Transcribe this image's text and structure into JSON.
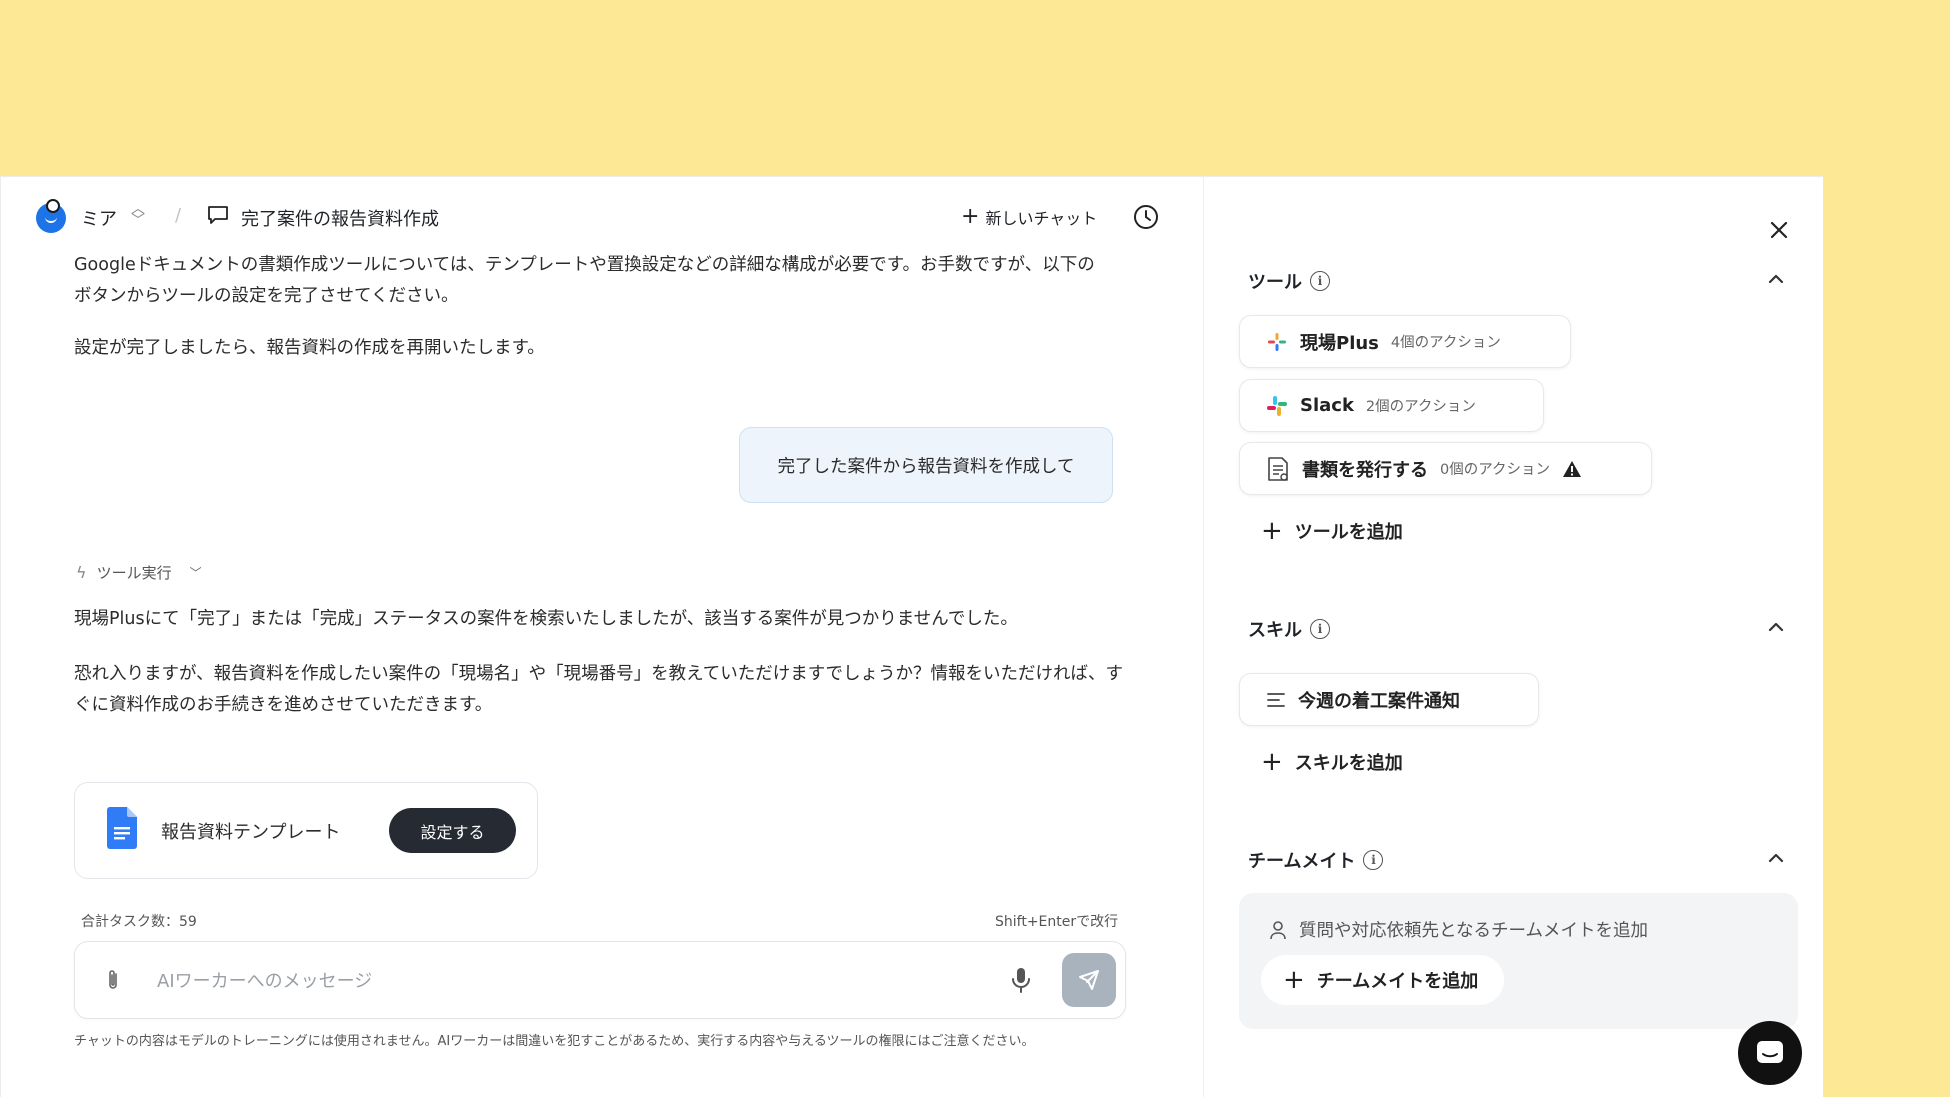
{
  "topbar": {
    "agent_name": "ミア",
    "separator": "/",
    "chat_title": "完了案件の報告資料作成",
    "new_chat_label": "新しいチャット"
  },
  "messages": {
    "assistant_1_line1": "Googleドキュメントの書類作成ツールについては、テンプレートや置換設定などの詳細な構成が必要です。お手数ですが、以下の",
    "assistant_1_line2": "ボタンからツールの設定を完了させてください。",
    "assistant_1_para2": "設定が完了しましたら、報告資料の作成を再開いたします。",
    "user_1": "完了した案件から報告資料を作成して",
    "tool_run_label": "ツール実行",
    "assistant_2_para1": "現場Plusにて「完了」または「完成」ステータスの案件を検索いたしましたが、該当する案件が見つかりませんでした。",
    "assistant_2_line1": "恐れ入りますが、報告資料を作成したい案件の「現場名」や「現場番号」を教えていただけますでしょうか？情報をいただければ、す",
    "assistant_2_line2": "ぐに資料作成のお手続きを進めさせていただきます。"
  },
  "doc_card": {
    "label": "報告資料テンプレート",
    "button_label": "設定する"
  },
  "composer": {
    "task_count": "合計タスク数：59",
    "shortcut_hint": "Shift+Enterで改行",
    "placeholder": "AIワーカーへのメッセージ",
    "value": "",
    "disclaimer": "チャットの内容はモデルのトレーニングには使用されません。AIワーカーは間違いを犯すことがあるため、実行する内容や与えるツールの権限にはご注意ください。"
  },
  "side": {
    "tools_title": "ツール",
    "tools": [
      {
        "name": "現場Plus",
        "actions": "4個のアクション",
        "icon": "genba-plus-icon"
      },
      {
        "name": "Slack",
        "actions": "2個のアクション",
        "icon": "slack-icon"
      },
      {
        "name": "書類を発行する",
        "actions": "0個のアクション",
        "icon": "document-icon",
        "warning": true
      }
    ],
    "add_tool_label": "ツールを追加",
    "skills_title": "スキル",
    "skills": [
      {
        "name": "今週の着工案件通知",
        "icon": "text-lines-icon"
      }
    ],
    "add_skill_label": "スキルを追加",
    "team_title": "チームメイト",
    "team_hint": "質問や対応依頼先となるチームメイトを追加",
    "add_team_label": "チームメイトを追加"
  },
  "colors": {
    "background": "#fde896",
    "primary_button": "#262a33",
    "user_bubble": "#eef4fb",
    "avatar": "#1d74e8",
    "send_button_disabled": "#a9b3bd"
  }
}
